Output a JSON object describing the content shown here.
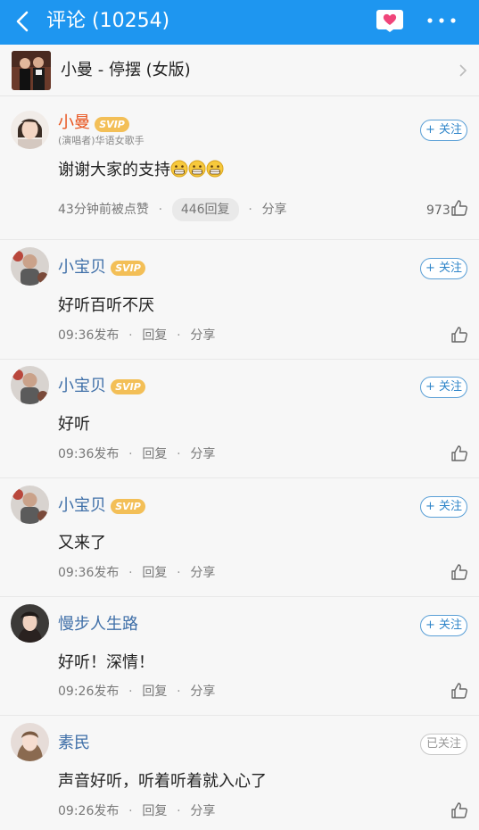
{
  "header": {
    "title": "评论 (10254)",
    "back_icon": "back-arrow-icon",
    "heart_icon": "heart-icon",
    "more_icon": "more-dots-icon",
    "bar_color": "#1e96f0"
  },
  "song": {
    "title": "小曼 - 停摆 (女版)",
    "cover_icon": "album-cover-icon",
    "chevron_icon": "chevron-right-icon"
  },
  "badge": {
    "svip": "SVIP"
  },
  "comments": [
    {
      "user": "小曼",
      "is_owner": true,
      "role": "(演唱者)华语女歌手",
      "follow": "+ 关注",
      "text": "谢谢大家的支持",
      "emoji_count": 3,
      "meta_time": "43分钟前被点赞",
      "reply": "446回复",
      "share": "分享",
      "likes": "973"
    },
    {
      "user": "小宝贝",
      "follow": "+ 关注",
      "text": "好听百听不厌",
      "meta_time": "09:36发布",
      "reply": "回复",
      "share": "分享"
    },
    {
      "user": "小宝贝",
      "follow": "+ 关注",
      "text": "好听",
      "meta_time": "09:36发布",
      "reply": "回复",
      "share": "分享"
    },
    {
      "user": "小宝贝",
      "follow": "+ 关注",
      "text": "又来了",
      "meta_time": "09:36发布",
      "reply": "回复",
      "share": "分享"
    },
    {
      "user": "慢步人生路",
      "follow": "+ 关注",
      "text": "好听！深情！",
      "meta_time": "09:26发布",
      "reply": "回复",
      "share": "分享"
    },
    {
      "user": "素民",
      "follow": "已关注",
      "text": "声音好听，听着听着就入心了",
      "meta_time": "09:26发布",
      "reply": "回复",
      "share": "分享"
    }
  ]
}
